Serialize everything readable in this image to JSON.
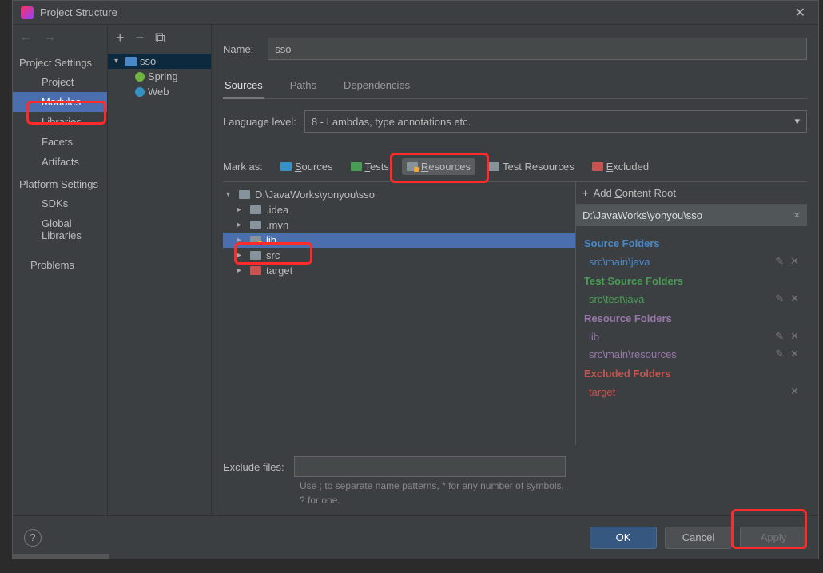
{
  "titlebar": {
    "title": "Project Structure"
  },
  "leftNav": {
    "section1": "Project Settings",
    "items1": [
      "Project",
      "Modules",
      "Libraries",
      "Facets",
      "Artifacts"
    ],
    "section2": "Platform Settings",
    "items2": [
      "SDKs",
      "Global Libraries"
    ],
    "problems": "Problems"
  },
  "moduleTree": {
    "root": "sso",
    "children": [
      "Spring",
      "Web"
    ]
  },
  "name": {
    "label": "Name:",
    "value": "sso"
  },
  "tabs": [
    "Sources",
    "Paths",
    "Dependencies"
  ],
  "langLevel": {
    "label": "Language level:",
    "value": "8 - Lambdas, type annotations etc."
  },
  "markAs": {
    "label": "Mark as:",
    "sources": "Sources",
    "tests": "Tests",
    "resources": "Resources",
    "testResources": "Test Resources",
    "excluded": "Excluded"
  },
  "fsTree": {
    "root": "D:\\JavaWorks\\yonyou\\sso",
    "children": [
      {
        "name": ".idea",
        "type": "plain"
      },
      {
        "name": ".mvn",
        "type": "plain"
      },
      {
        "name": "lib",
        "type": "res",
        "selected": true
      },
      {
        "name": "src",
        "type": "plain"
      },
      {
        "name": "target",
        "type": "orange"
      }
    ]
  },
  "roots": {
    "addLabel": "Add Content Root",
    "path": "D:\\JavaWorks\\yonyou\\sso",
    "groups": [
      {
        "title": "Source Folders",
        "cls": "rg-source",
        "items": [
          {
            "label": "src\\main\\java",
            "cls": "ri-source",
            "editable": true
          }
        ]
      },
      {
        "title": "Test Source Folders",
        "cls": "rg-test",
        "items": [
          {
            "label": "src\\test\\java",
            "cls": "ri-test",
            "editable": true
          }
        ]
      },
      {
        "title": "Resource Folders",
        "cls": "rg-res",
        "items": [
          {
            "label": "lib",
            "cls": "ri-res",
            "editable": true
          },
          {
            "label": "src\\main\\resources",
            "cls": "ri-res",
            "editable": true
          }
        ]
      },
      {
        "title": "Excluded Folders",
        "cls": "rg-excl",
        "items": [
          {
            "label": "target",
            "cls": "ri-excl",
            "editable": false
          }
        ]
      }
    ]
  },
  "exclude": {
    "label": "Exclude files:",
    "hint": "Use ; to separate name patterns, * for any number of symbols, ? for one."
  },
  "buttons": {
    "ok": "OK",
    "cancel": "Cancel",
    "apply": "Apply"
  }
}
